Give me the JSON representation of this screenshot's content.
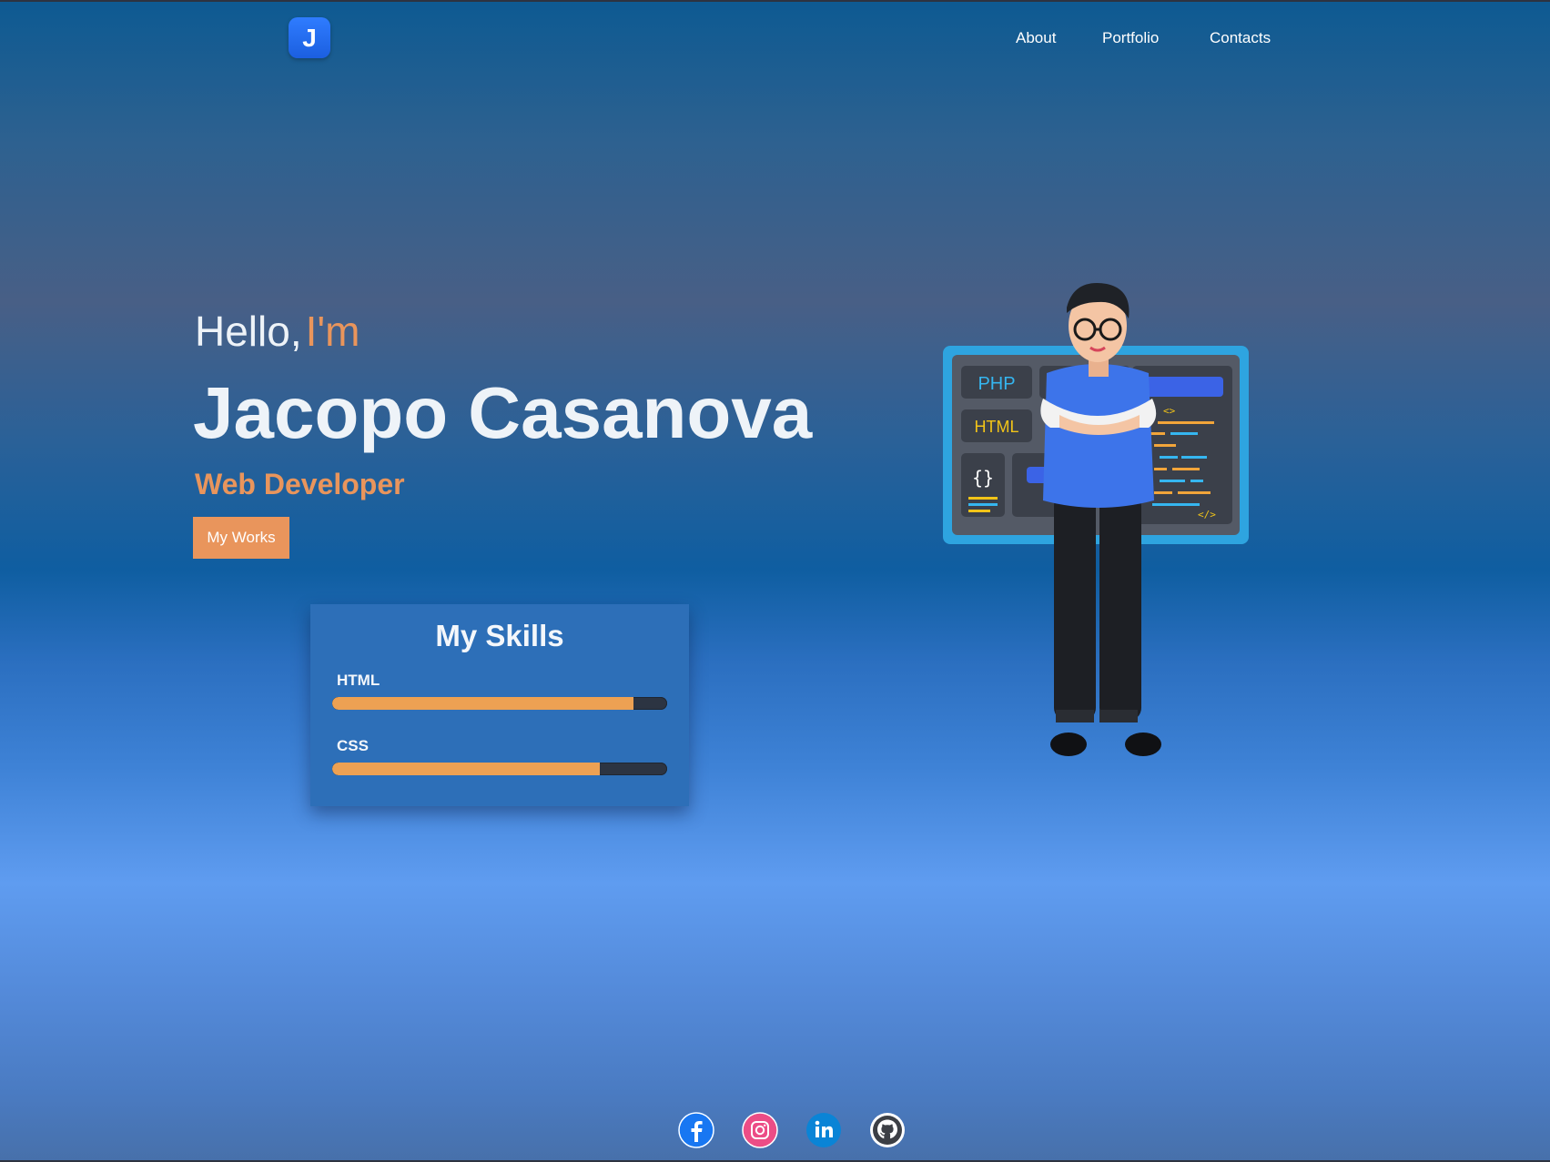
{
  "brand": {
    "logo_letter": "J",
    "logo_color": "#1f6bf0"
  },
  "nav": {
    "items": [
      {
        "label": "About"
      },
      {
        "label": "Portfolio"
      },
      {
        "label": "Contacts"
      }
    ]
  },
  "hero": {
    "greeting": "Hello,",
    "greeting_accent": "I'm",
    "name": "Jacopo Casanova",
    "role": "Web Developer",
    "cta_label": "My Works"
  },
  "skills": {
    "title": "My Skills",
    "items": [
      {
        "label": "HTML",
        "level": 0.9
      },
      {
        "label": "CSS",
        "level": 0.8
      }
    ]
  },
  "illustration": {
    "board_tags": [
      "PHP",
      "HTML",
      "{}",
      "<>",
      "</>"
    ]
  },
  "social": [
    {
      "name": "facebook-icon"
    },
    {
      "name": "instagram-icon"
    },
    {
      "name": "linkedin-icon"
    },
    {
      "name": "github-icon"
    }
  ],
  "colors": {
    "accent": "#e9955c",
    "bar_fill": "#eda153",
    "bar_track": "#2c3442",
    "panel": "#2d6fb8"
  }
}
